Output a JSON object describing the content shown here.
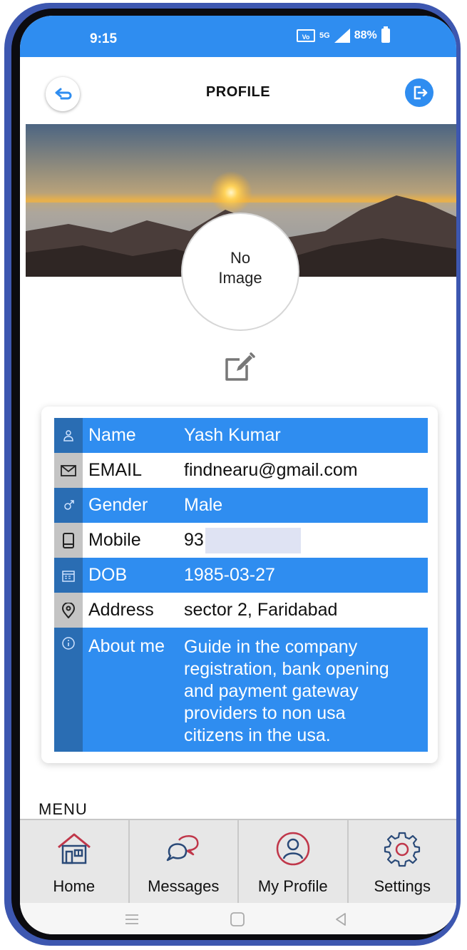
{
  "status_bar": {
    "time": "9:15",
    "network": "5G",
    "battery_text": "88%"
  },
  "header": {
    "title": "PROFILE",
    "back_icon": "back-arrow-icon",
    "logout_icon": "logout-icon"
  },
  "avatar": {
    "line1": "No",
    "line2": "Image"
  },
  "profile": {
    "rows": [
      {
        "icon": "person-icon",
        "label": "Name",
        "value": "Yash Kumar"
      },
      {
        "icon": "mail-icon",
        "label": "EMAIL",
        "value": "findnearu@gmail.com"
      },
      {
        "icon": "gender-icon",
        "label": "Gender",
        "value": "Male"
      },
      {
        "icon": "phone-icon",
        "label": "Mobile",
        "value": "93"
      },
      {
        "icon": "calendar-icon",
        "label": "DOB",
        "value": "1985-03-27"
      },
      {
        "icon": "location-icon",
        "label": "Address",
        "value": "sector 2, Faridabad"
      },
      {
        "icon": "info-icon",
        "label": "About me",
        "value": [
          "Guide in the company",
          "registration, bank opening",
          "and payment gateway",
          "providers to non usa",
          "citizens in the usa."
        ]
      }
    ]
  },
  "menu": {
    "label": "MENU"
  },
  "bottom_nav": [
    {
      "label": "Home",
      "icon": "home-icon"
    },
    {
      "label": "Messages",
      "icon": "messages-icon"
    },
    {
      "label": "My Profile",
      "icon": "user-icon"
    },
    {
      "label": "Settings",
      "icon": "gear-icon"
    }
  ],
  "colors": {
    "accent": "#2f8df0",
    "accent_dark": "#2a6db3",
    "frame": "#3d57b0",
    "nav_icon": "#c0374a"
  }
}
